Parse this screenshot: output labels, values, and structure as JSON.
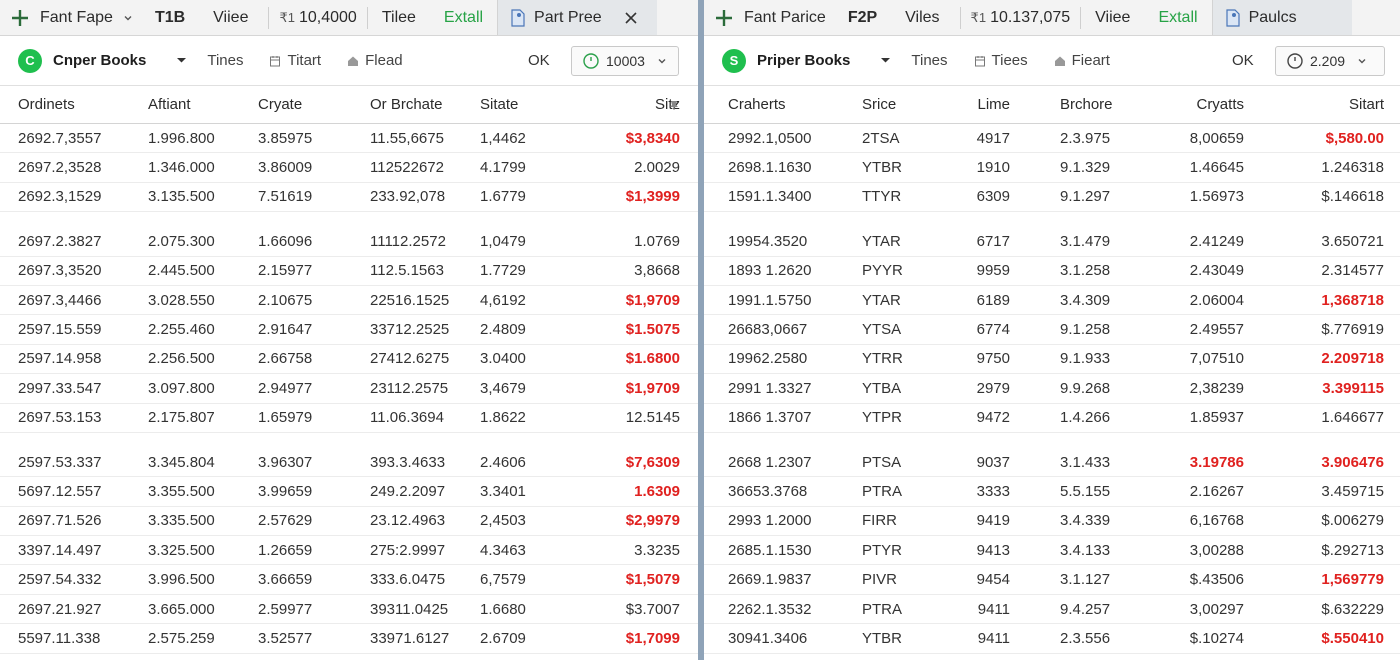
{
  "left": {
    "toolbar": {
      "tab1_label": "Fant Fape",
      "tab1_code": "T1B",
      "view_label": "Viiee",
      "count_prefix": "₹1",
      "count_value": "10,4000",
      "tile_label": "Tilee",
      "extall_label": "Extall",
      "active_tab_label": "Part Pree"
    },
    "subbar": {
      "logo_letter": "C",
      "brand": "Cnper Books",
      "link1": "Tines",
      "link2": "Titart",
      "link3": "Flead",
      "ok_label": "OK",
      "stepper_value": "10003"
    },
    "table": {
      "headers": [
        "Ordinets",
        "Aftiant",
        "Cryate",
        "Or Brchate",
        "Sitate",
        "Sitz"
      ],
      "rows": [
        [
          "2692.7,3557",
          "1.996.800",
          "3.85975",
          "11.55,6675",
          "1,4462",
          "$3,8340"
        ],
        [
          "2697.2,3528",
          "1.346.000",
          "3.86009",
          "11252267​2",
          "4.1799",
          "2.0029"
        ],
        [
          "2692.3,1529",
          "3.135.500",
          "7.51619",
          "233.92,078",
          "1.6779",
          "$1,3999"
        ],
        [
          "2697.2.3827",
          "2.075.300",
          "1.66096",
          "11112.2572",
          "1,0479",
          "1.0769"
        ],
        [
          "2697.3,3520",
          "2.445.500",
          "2.15977",
          "112.5.1563",
          "1.7729",
          "3,8668"
        ],
        [
          "2697.3,4466",
          "3.028.550",
          "2.10675",
          "22516.1525",
          "4,6192",
          "$1,9709"
        ],
        [
          "2597.15.559",
          "2.255.460",
          "2.91647",
          "33712.2525",
          "2.4809",
          "$1.5075"
        ],
        [
          "2597.14.958",
          "2.256.500",
          "2.66758",
          "27412.6275",
          "3.0400",
          "$1.6800"
        ],
        [
          "2997.33.547",
          "3.097.800",
          "2.94977",
          "23112.2575",
          "3,4679",
          "$1,9709"
        ],
        [
          "2697.53.153",
          "2.175.807",
          "1.65979",
          "11.06.3694",
          "1.8622",
          "12.5145"
        ],
        [
          "2597.53.337",
          "3.345.804",
          "3.96307",
          "393.3.4633",
          "2.4606",
          "$7,6309"
        ],
        [
          "5697.12.557",
          "3.355.500",
          "3.99659",
          "249.2.2097",
          "3.3401",
          "1.6309"
        ],
        [
          "2697.71.526",
          "3.335.500",
          "2.57629",
          "23.12.4963",
          "2,4503",
          "$2,9979"
        ],
        [
          "3397.14.497",
          "3.325.500",
          "1.26659",
          "275:2.9997",
          "4.3463",
          "3.3235"
        ],
        [
          "2597.54.332",
          "3.996.500",
          "3.66659",
          "333.6.0475",
          "6,7579",
          "$1,5079"
        ],
        [
          "2697.21.927",
          "3.665.000",
          "2.59977",
          "39311.0425",
          "1.6680",
          "$3.7007"
        ],
        [
          "5597.11.338",
          "2.575.259",
          "3.52577",
          "33971.6127",
          "2.6709",
          "$1,7099"
        ]
      ],
      "negative": [
        true,
        false,
        true,
        false,
        false,
        true,
        true,
        true,
        true,
        false,
        true,
        true,
        true,
        false,
        true,
        false,
        true
      ]
    }
  },
  "right": {
    "toolbar": {
      "tab1_label": "Fant Parice",
      "tab1_code": "F2P",
      "view_label": "Viles",
      "count_prefix": "₹1",
      "count_value": "10.137,075",
      "tile_label": "Viiee",
      "extall_label": "Extall",
      "active_tab_label": "Paulcs"
    },
    "subbar": {
      "logo_letter": "S",
      "brand": "Priper Books",
      "link1": "Tines",
      "link2": "Tiees",
      "link3": "Fieart",
      "ok_label": "OK",
      "stepper_value": "2.209"
    },
    "table": {
      "headers": [
        "Craherts",
        "Srice",
        "Lime",
        "Brchore",
        "Cryatts",
        "Sitart"
      ],
      "rows": [
        [
          "2992.1,0500",
          "2TSA",
          "4917",
          "2.3.975",
          "8,00659",
          "$,580.00"
        ],
        [
          "2698.1.1630",
          "YTBR",
          "1910",
          "9.1.329",
          "1.46645",
          "1.246318"
        ],
        [
          "1591.1.3400",
          "TTYR",
          "6309",
          "9.1.297",
          "1.56973",
          "$.146618"
        ],
        [
          "19954.3520",
          "YTAR",
          "6717",
          "3.1.479",
          "2.41249",
          "3.650721"
        ],
        [
          "1893 1.2620",
          "PYYR",
          "9959",
          "3.1.258",
          "2.43049",
          "2.314577"
        ],
        [
          "1991.1.5750",
          "YTAR",
          "6189",
          "3.4.309",
          "2.06004",
          "1,368718"
        ],
        [
          "26683,0667",
          "YTSA",
          "6774",
          "9.1.258",
          "2.49557",
          "$.776919"
        ],
        [
          "19962.2580",
          "YTRR",
          "9750",
          "9.1.933",
          "7,07510",
          "2.209718"
        ],
        [
          "2991 1.3327",
          "YTBA",
          "2979",
          "9.9.268",
          "2,38239",
          "3.399115"
        ],
        [
          "1866 1.3707",
          "YTPR",
          "9472",
          "1.4.266",
          "1.85937",
          "1.646677"
        ],
        [
          "2668 1.2307",
          "PTSA",
          "9037",
          "3.1.433",
          "3.19786",
          "3.906476"
        ],
        [
          "36653.3768",
          "PTRA",
          "3333",
          "5.5.155",
          "2.16267",
          "3.459715"
        ],
        [
          "2993 1.2000",
          "FIRR",
          "9419",
          "3.4.339",
          "6,16768",
          "$.006279"
        ],
        [
          "2685.1.1530",
          "PTYR",
          "9413",
          "3.4.133",
          "3,00288",
          "$.292713"
        ],
        [
          "2669.1.9837",
          "PIVR",
          "9454",
          "3.1.127",
          "$.43506",
          "1,569779"
        ],
        [
          "2262.1.3532",
          "PTRA",
          "9411",
          "9.4.257",
          "3,00297",
          "$.632229"
        ],
        [
          "30941.3406",
          "YTBR",
          "9411",
          "2.3.556",
          "$.10274",
          "$.550410"
        ]
      ],
      "negative": [
        true,
        false,
        false,
        false,
        false,
        true,
        false,
        true,
        true,
        false,
        true,
        false,
        false,
        false,
        true,
        false,
        true
      ],
      "negative_col5": [
        false,
        false,
        false,
        false,
        false,
        false,
        false,
        false,
        false,
        false,
        true,
        false,
        false,
        false,
        false,
        false,
        false
      ]
    },
    "accent": "#e0211f"
  },
  "colors": {
    "green": "#27a346",
    "logo": "#1fbf4e",
    "negative": "#e0211f",
    "divider": "#8fa3b8"
  }
}
